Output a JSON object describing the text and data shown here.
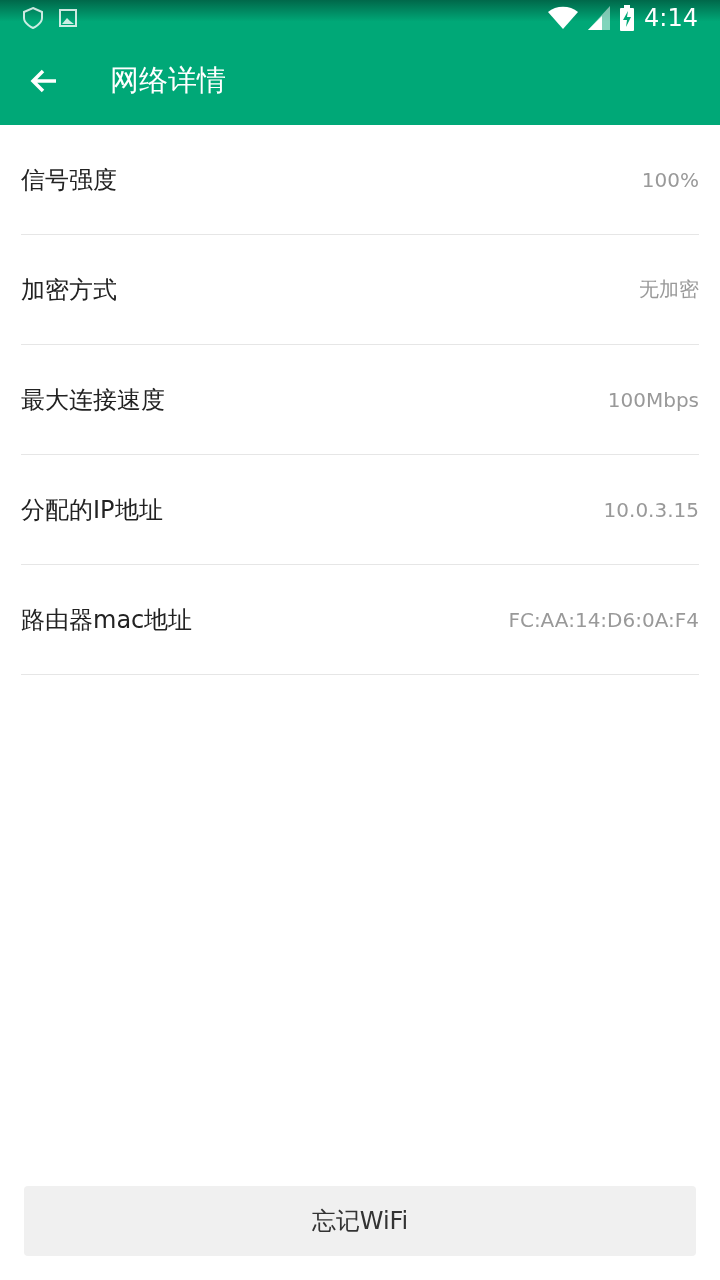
{
  "status_bar": {
    "time": "4:14"
  },
  "app_bar": {
    "title": "网络详情"
  },
  "details": [
    {
      "label": "信号强度",
      "value": "100%"
    },
    {
      "label": "加密方式",
      "value": "无加密"
    },
    {
      "label": "最大连接速度",
      "value": "100Mbps"
    },
    {
      "label": "分配的IP地址",
      "value": "10.0.3.15"
    },
    {
      "label": "路由器mac地址",
      "value": "FC:AA:14:D6:0A:F4"
    }
  ],
  "buttons": [
    "忘记WiFi"
  ]
}
